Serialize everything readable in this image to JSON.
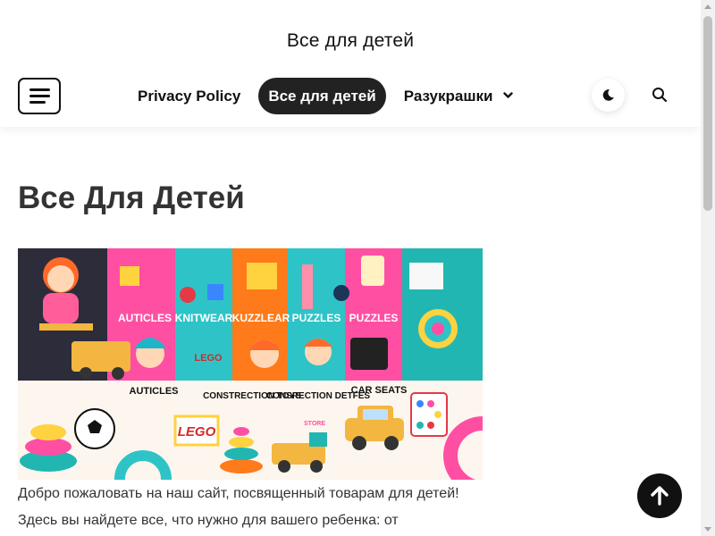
{
  "site": {
    "title": "Все для детей"
  },
  "nav": {
    "items": [
      {
        "label": "Privacy Policy"
      },
      {
        "label": "Все для детей"
      },
      {
        "label": "Разукрашки"
      }
    ]
  },
  "icons": {
    "menu": "hamburger-icon",
    "dark_mode": "moon-icon",
    "search": "search-icon",
    "dropdown": "chevron-down-icon",
    "back_to_top": "arrow-up-icon"
  },
  "page": {
    "title": "Все Для Детей",
    "banner_labels": {
      "row1": [
        "AUTICLES",
        "KNITWEAR",
        "KUZZLEAR",
        "PUZZLES",
        "PUZZLES"
      ],
      "row2": [
        "AUTICLES",
        "CONSTRECTION TOYS",
        "CONSRECTION DETFES",
        "CAR SEATS"
      ],
      "lego": "LEGO",
      "store": "STORE"
    },
    "intro": "Добро пожаловать на наш сайт, посвященный товарам для детей! Здесь вы найдете все, что нужно для вашего ребенка: от"
  },
  "colors": {
    "accent": "#222222",
    "nav_active_text": "#ffffff"
  }
}
